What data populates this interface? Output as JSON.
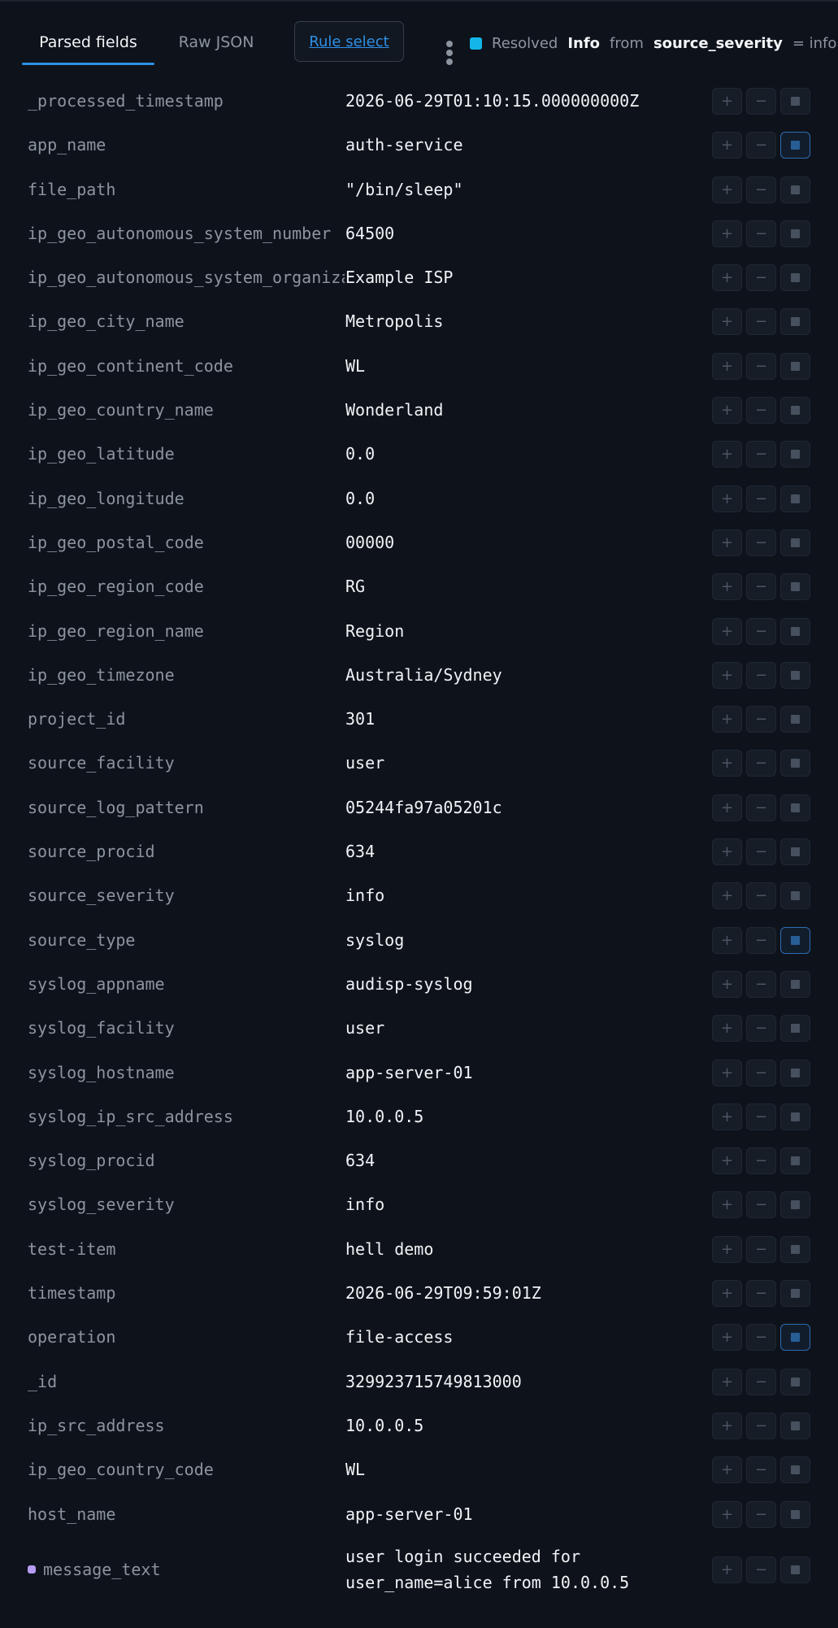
{
  "tabs": [
    {
      "label": "Parsed fields",
      "active": true
    },
    {
      "label": "Raw JSON",
      "active": false
    }
  ],
  "rule_select_label": "Rule select",
  "resolved": {
    "label": "Resolved",
    "level": "Info",
    "from": "from",
    "field": "source_severity",
    "equals": "= info"
  },
  "actions": {
    "include": "+",
    "exclude": "−"
  },
  "colors": {
    "accent": "#2f8fe6",
    "resolved_dot": "#13b6e8",
    "message_marker": "#b69cf2"
  },
  "rows": [
    {
      "key": "_processed_timestamp",
      "value": "2026-06-29T01:10:15.000000000Z",
      "toggle_on": false
    },
    {
      "key": "app_name",
      "value": "auth-service",
      "toggle_on": true
    },
    {
      "key": "file_path",
      "value": "\"/bin/sleep\"",
      "toggle_on": false
    },
    {
      "key": "ip_geo_autonomous_system_number",
      "value": "64500",
      "toggle_on": false
    },
    {
      "key": "ip_geo_autonomous_system_organization",
      "value": "Example ISP",
      "toggle_on": false
    },
    {
      "key": "ip_geo_city_name",
      "value": "Metropolis",
      "toggle_on": false
    },
    {
      "key": "ip_geo_continent_code",
      "value": "WL",
      "toggle_on": false
    },
    {
      "key": "ip_geo_country_name",
      "value": "Wonderland",
      "toggle_on": false
    },
    {
      "key": "ip_geo_latitude",
      "value": "0.0",
      "toggle_on": false
    },
    {
      "key": "ip_geo_longitude",
      "value": "0.0",
      "toggle_on": false
    },
    {
      "key": "ip_geo_postal_code",
      "value": "00000",
      "toggle_on": false
    },
    {
      "key": "ip_geo_region_code",
      "value": "RG",
      "toggle_on": false
    },
    {
      "key": "ip_geo_region_name",
      "value": "Region",
      "toggle_on": false
    },
    {
      "key": "ip_geo_timezone",
      "value": "Australia/Sydney",
      "toggle_on": false
    },
    {
      "key": "project_id",
      "value": "301",
      "toggle_on": false
    },
    {
      "key": "source_facility",
      "value": "user",
      "toggle_on": false
    },
    {
      "key": "source_log_pattern",
      "value": "05244fa97a05201c",
      "toggle_on": false
    },
    {
      "key": "source_procid",
      "value": "634",
      "toggle_on": false
    },
    {
      "key": "source_severity",
      "value": "info",
      "toggle_on": false
    },
    {
      "key": "source_type",
      "value": "syslog",
      "toggle_on": true
    },
    {
      "key": "syslog_appname",
      "value": "audisp-syslog",
      "toggle_on": false
    },
    {
      "key": "syslog_facility",
      "value": "user",
      "toggle_on": false
    },
    {
      "key": "syslog_hostname",
      "value": "app-server-01",
      "toggle_on": false
    },
    {
      "key": "syslog_ip_src_address",
      "value": "10.0.0.5",
      "toggle_on": false
    },
    {
      "key": "syslog_procid",
      "value": "634",
      "toggle_on": false
    },
    {
      "key": "syslog_severity",
      "value": "info",
      "toggle_on": false
    },
    {
      "key": "test-item",
      "value": "hell demo",
      "toggle_on": false
    },
    {
      "key": "timestamp",
      "value": "2026-06-29T09:59:01Z",
      "toggle_on": false
    },
    {
      "key": "operation",
      "value": "file-access",
      "toggle_on": true
    },
    {
      "key": "_id",
      "value": "329923715749813000",
      "toggle_on": false
    },
    {
      "key": "ip_src_address",
      "value": "10.0.0.5",
      "toggle_on": false
    },
    {
      "key": "ip_geo_country_code",
      "value": "WL",
      "toggle_on": false
    },
    {
      "key": "host_name",
      "value": "app-server-01",
      "toggle_on": false
    },
    {
      "key": "message_text",
      "value": "user login succeeded for user_name=alice from 10.0.0.5",
      "toggle_on": false,
      "marked": true,
      "multiline": true
    }
  ]
}
